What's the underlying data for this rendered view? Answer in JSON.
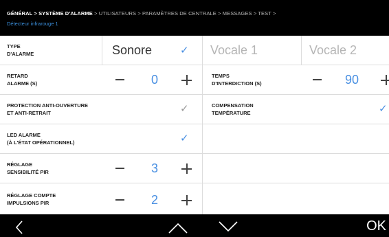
{
  "breadcrumb": {
    "part1": "GÉNÉRAL > SYSTÈME D'ALARME",
    "part2": " > UTILISATEURS > PARAMÈTRES DE CENTRALE > MESSAGES > TEST >",
    "subtitle": "Détecteur infrarouge 1"
  },
  "rows": {
    "type_alarme": {
      "label_line1": "TYPE",
      "label_line2": "D'ALARME",
      "option1": "Sonore",
      "option2": "Vocale 1",
      "option3": "Vocale 2",
      "selected": "Sonore"
    },
    "retard": {
      "label_line1": "RETARD",
      "label_line2": "ALARME (S)",
      "value": "0"
    },
    "temps": {
      "label_line1": "TEMPS",
      "label_line2": "D'INTERDICTION (S)",
      "value": "90"
    },
    "protection": {
      "label_line1": "PROTECTION ANTI-OUVERTURE",
      "label_line2": "ET ANTI-RETRAIT",
      "checked": true
    },
    "compensation": {
      "label_line1": "COMPENSATION",
      "label_line2": "TEMPÉRATURE",
      "checked": true
    },
    "led": {
      "label_line1": "LED ALARME",
      "label_line2": "(À L'ÉTAT OPÉRATIONNEL)",
      "checked": true
    },
    "sensibilite": {
      "label_line1": "RÉGLAGE",
      "label_line2": "SENSIBILITÉ PIR",
      "value": "3"
    },
    "impulsions": {
      "label_line1": "RÉGLAGE COMPTE",
      "label_line2": "IMPULSIONS PIR",
      "value": "2"
    }
  },
  "footer": {
    "ok_label": "OK"
  },
  "colors": {
    "accent": "#4a90e2",
    "check_grey": "#9a9a9a",
    "background": "#ffffff",
    "bar": "#000000"
  }
}
